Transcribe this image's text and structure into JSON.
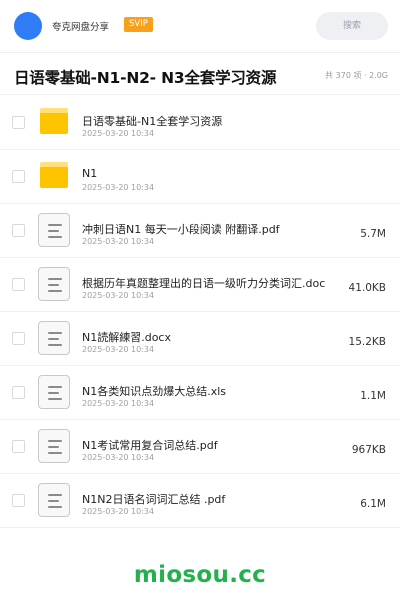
{
  "header": {
    "username": "夸克网盘分享",
    "badge": "SVIP",
    "search_label": "搜索"
  },
  "share": {
    "title": "日语零基础-N1-N2- N3全套学习资源",
    "meta": "共 370 项 · 2.0G"
  },
  "files": [
    {
      "type": "folder",
      "name": "日语零基础-N1全套学习资源",
      "date": "2025-03-20 10:34",
      "size": ""
    },
    {
      "type": "folder",
      "name": "N1",
      "date": "2025-03-20 10:34",
      "size": ""
    },
    {
      "type": "file",
      "name": "冲刺日语N1 每天一小段阅读 附翻译.pdf",
      "date": "2025-03-20 10:34",
      "size": "5.7M"
    },
    {
      "type": "file",
      "name": "根据历年真题整理出的日语一级听力分类词汇.doc",
      "date": "2025-03-20 10:34",
      "size": "41.0KB"
    },
    {
      "type": "file",
      "name": "N1読解練習.docx",
      "date": "2025-03-20 10:34",
      "size": "15.2KB"
    },
    {
      "type": "file",
      "name": "N1各类知识点劲爆大总结.xls",
      "date": "2025-03-20 10:34",
      "size": "1.1M"
    },
    {
      "type": "file",
      "name": "N1考试常用复合词总结.pdf",
      "date": "2025-03-20 10:34",
      "size": "967KB"
    },
    {
      "type": "file",
      "name": "N1N2日语名词词汇总结 .pdf",
      "date": "2025-03-20 10:34",
      "size": "6.1M"
    }
  ],
  "watermark": "miosou.cc",
  "colors": {
    "accent": "#2f7cf6",
    "badge": "#f7a11a",
    "folder": "#ffc400",
    "watermark": "#22b14c"
  }
}
